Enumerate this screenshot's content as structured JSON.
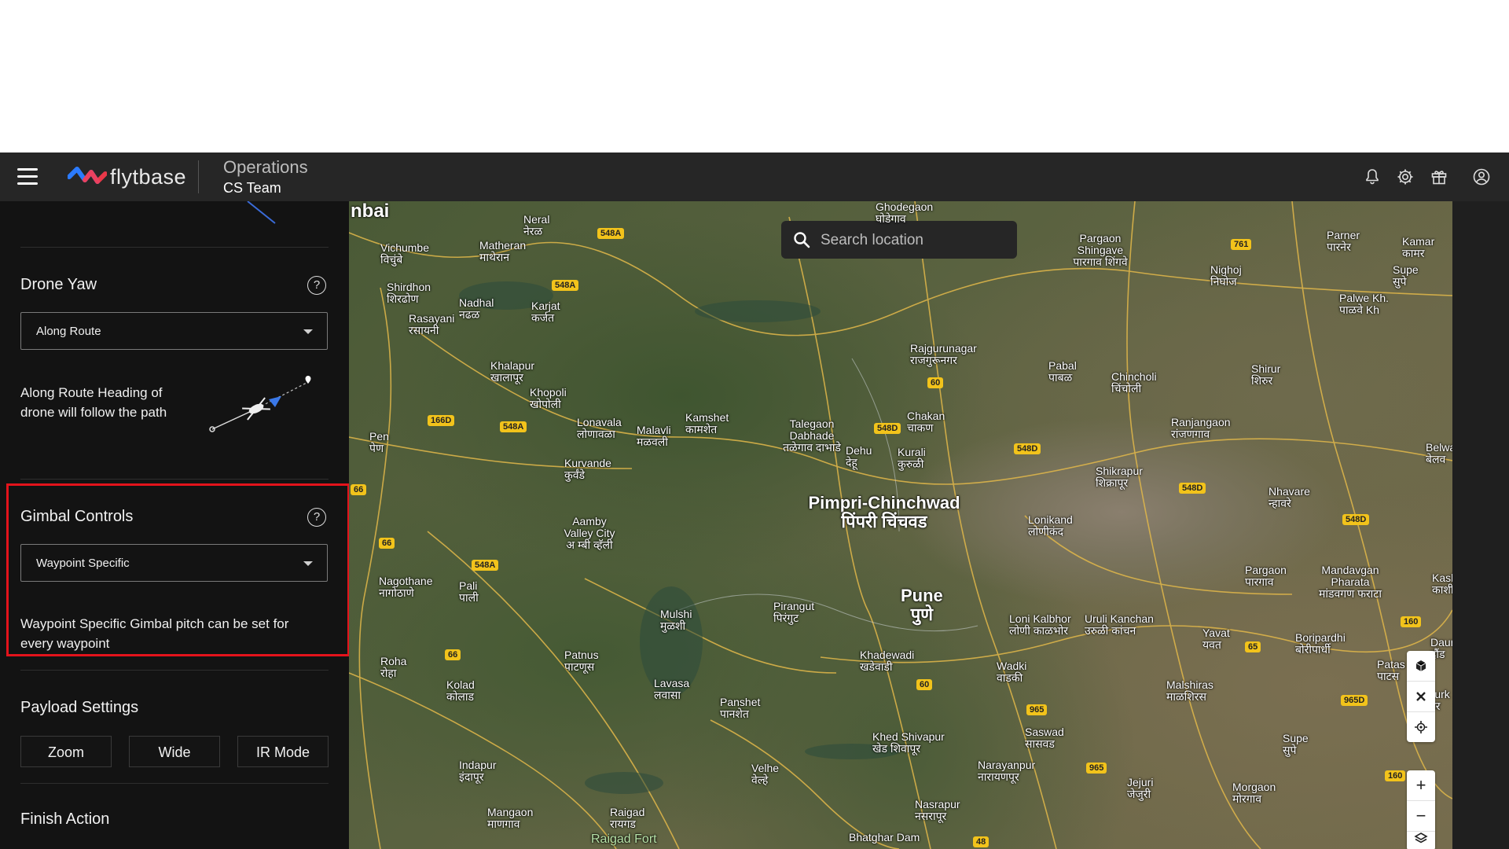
{
  "header": {
    "brand": "flytbase",
    "section_title": "Operations",
    "team": "CS Team"
  },
  "sidebar": {
    "drone_yaw": {
      "title": "Drone Yaw",
      "help": "?",
      "selected": "Along Route",
      "description_line1": "Along Route Heading of",
      "description_line2": "drone will follow the path"
    },
    "gimbal": {
      "title": "Gimbal Controls",
      "help": "?",
      "selected": "Waypoint Specific",
      "description_line1": "Waypoint Specific Gimbal pitch can be set for",
      "description_line2": "every waypoint"
    },
    "payload": {
      "title": "Payload Settings",
      "buttons": [
        "Zoom",
        "Wide",
        "IR Mode"
      ]
    },
    "finish": {
      "title": "Finish Action"
    }
  },
  "map": {
    "search_placeholder": "Search location",
    "places": [
      {
        "n": "nbai",
        "t": "mumbai"
      },
      {
        "n": "Vichumbe",
        "d": "विचुंबे"
      },
      {
        "n": "Neral",
        "d": "नेरळ"
      },
      {
        "n": "Matheran",
        "d": "माथेरान"
      },
      {
        "n": "Shirdhon",
        "d": "शिरढोण"
      },
      {
        "n": "Nadhal",
        "d": "नढळ"
      },
      {
        "n": "Karjat",
        "d": "कर्जत"
      },
      {
        "n": "Rasayani",
        "d": "रसायनी"
      },
      {
        "n": "Khalapur",
        "d": "खालापूर"
      },
      {
        "n": "Khopoli",
        "d": "खोपोली"
      },
      {
        "n": "Lonavala",
        "d": "लोणावळा"
      },
      {
        "n": "Malavli",
        "d": "मळवली"
      },
      {
        "n": "Kamshet",
        "d": "कामशेत"
      },
      {
        "n": "Talegaon Dabhade",
        "d": "तळेगाव दाभाडे"
      },
      {
        "n": "Dehu",
        "d": "देहू"
      },
      {
        "n": "Kurali",
        "d": "कुरुळी"
      },
      {
        "n": "Chakan",
        "d": "चाकण"
      },
      {
        "n": "Rajgurunagar",
        "d": "राजगुरूनगर"
      },
      {
        "n": "Ghodegaon",
        "d": "घोडेगाव"
      },
      {
        "n": "Pargaon Shingave",
        "d": "पारगाव शिंगवे"
      },
      {
        "n": "Nighoj",
        "d": "निघोज"
      },
      {
        "n": "Parner",
        "d": "पारनेर"
      },
      {
        "n": "Kamar",
        "d": "कामर"
      },
      {
        "n": "Supe",
        "d": "सुपे"
      },
      {
        "n": "Palwe Kh.",
        "d": "पाळवे Kh"
      },
      {
        "n": "Pabal",
        "d": "पाबळ"
      },
      {
        "n": "Chincholi",
        "d": "चिंचोली"
      },
      {
        "n": "Shirur",
        "d": "शिरुर"
      },
      {
        "n": "Ranjangaon",
        "d": "रांजणगाव"
      },
      {
        "n": "Belwa",
        "d": "बेलव"
      },
      {
        "n": "Shikrapur",
        "d": "शिक्रापूर"
      },
      {
        "n": "Nhavare",
        "d": "न्हावरे"
      },
      {
        "n": "Lonikand",
        "d": "लोणीकंद"
      },
      {
        "n": "Pimpri-Chinchwad",
        "d": "पिंपरी चिंचवड"
      },
      {
        "n": "Pune",
        "d": "पुणे"
      },
      {
        "n": "Pen",
        "d": "पेण"
      },
      {
        "n": "Kurvande",
        "d": "कुर्वंडे"
      },
      {
        "n": "Aamby Valley City",
        "d": "अ म्बी व्हॅली"
      },
      {
        "n": "Nagothane",
        "d": "नागोठाणे"
      },
      {
        "n": "Pali",
        "d": "पाली"
      },
      {
        "n": "Mulshi",
        "d": "मुळशी"
      },
      {
        "n": "Pirangut",
        "d": "पिरंगुट"
      },
      {
        "n": "Loni Kalbhor",
        "d": "लोणी काळभोर"
      },
      {
        "n": "Uruli Kanchan",
        "d": "उरुळी कांचन"
      },
      {
        "n": "Yavat",
        "d": "यवत"
      },
      {
        "n": "Pargaon",
        "d": "पारगाव"
      },
      {
        "n": "Mandavgan Pharata",
        "d": "मांडवगण फराटा"
      },
      {
        "n": "Kash",
        "d": "काशी"
      },
      {
        "n": "Daur",
        "d": "दौंड"
      },
      {
        "n": "Boripardhi",
        "d": "बोरीपार्धी"
      },
      {
        "n": "Patas",
        "d": "पाटस"
      },
      {
        "n": "Roha",
        "d": "रोहा"
      },
      {
        "n": "Kolad",
        "d": "कोलाड"
      },
      {
        "n": "Patnus",
        "d": "पाटणूस"
      },
      {
        "n": "Lavasa",
        "d": "लवासा"
      },
      {
        "n": "Panshet",
        "d": "पानशेत"
      },
      {
        "n": "Khadewadi",
        "d": "खडेवाडी"
      },
      {
        "n": "Wadki",
        "d": "वाडकी"
      },
      {
        "n": "Malshiras",
        "d": "माळशिरस"
      },
      {
        "n": "Kurk",
        "d": "कुर"
      },
      {
        "n": "Khed Shivapur",
        "d": "खेड शिवापूर"
      },
      {
        "n": "Saswad",
        "d": "सासवड"
      },
      {
        "n": "Supe",
        "d": "सुपे"
      },
      {
        "n": "Indapur",
        "d": "इंदापूर"
      },
      {
        "n": "Velhe",
        "d": "वेल्हे"
      },
      {
        "n": "Narayanpur",
        "d": "नारायणपूर"
      },
      {
        "n": "Jejuri",
        "d": "जेजुरी"
      },
      {
        "n": "Morgaon",
        "d": "मोरगाव"
      },
      {
        "n": "Mangaon",
        "d": "माणगाव"
      },
      {
        "n": "Raigad",
        "d": "रायगड"
      },
      {
        "n": "Nasrapur",
        "d": "नसरापूर"
      },
      {
        "n": "Raigad Fort"
      },
      {
        "n": "Bhatghar Dam"
      }
    ],
    "shields": [
      "548A",
      "548A",
      "548A",
      "548A",
      "166D",
      "761",
      "60",
      "548D",
      "548D",
      "548D",
      "548D",
      "66",
      "66",
      "66",
      "60",
      "965",
      "965",
      "65",
      "160",
      "160",
      "965D",
      "48"
    ]
  },
  "colors": {
    "header_bg": "#262626",
    "sidebar_bg": "#131313",
    "highlight_border": "#e3131b",
    "brand_blue": "#2b7bff",
    "brand_red": "#ff3b4e",
    "road_shield": "#f2c31b"
  },
  "icons": [
    "hamburger-menu-icon",
    "bell-icon",
    "gear-icon",
    "gift-icon",
    "account-circle-icon",
    "search-icon",
    "help-icon",
    "chevron-down-icon",
    "3d-cube-icon",
    "drone-icon",
    "locate-icon",
    "zoom-in-icon",
    "zoom-out-icon",
    "layers-icon"
  ]
}
